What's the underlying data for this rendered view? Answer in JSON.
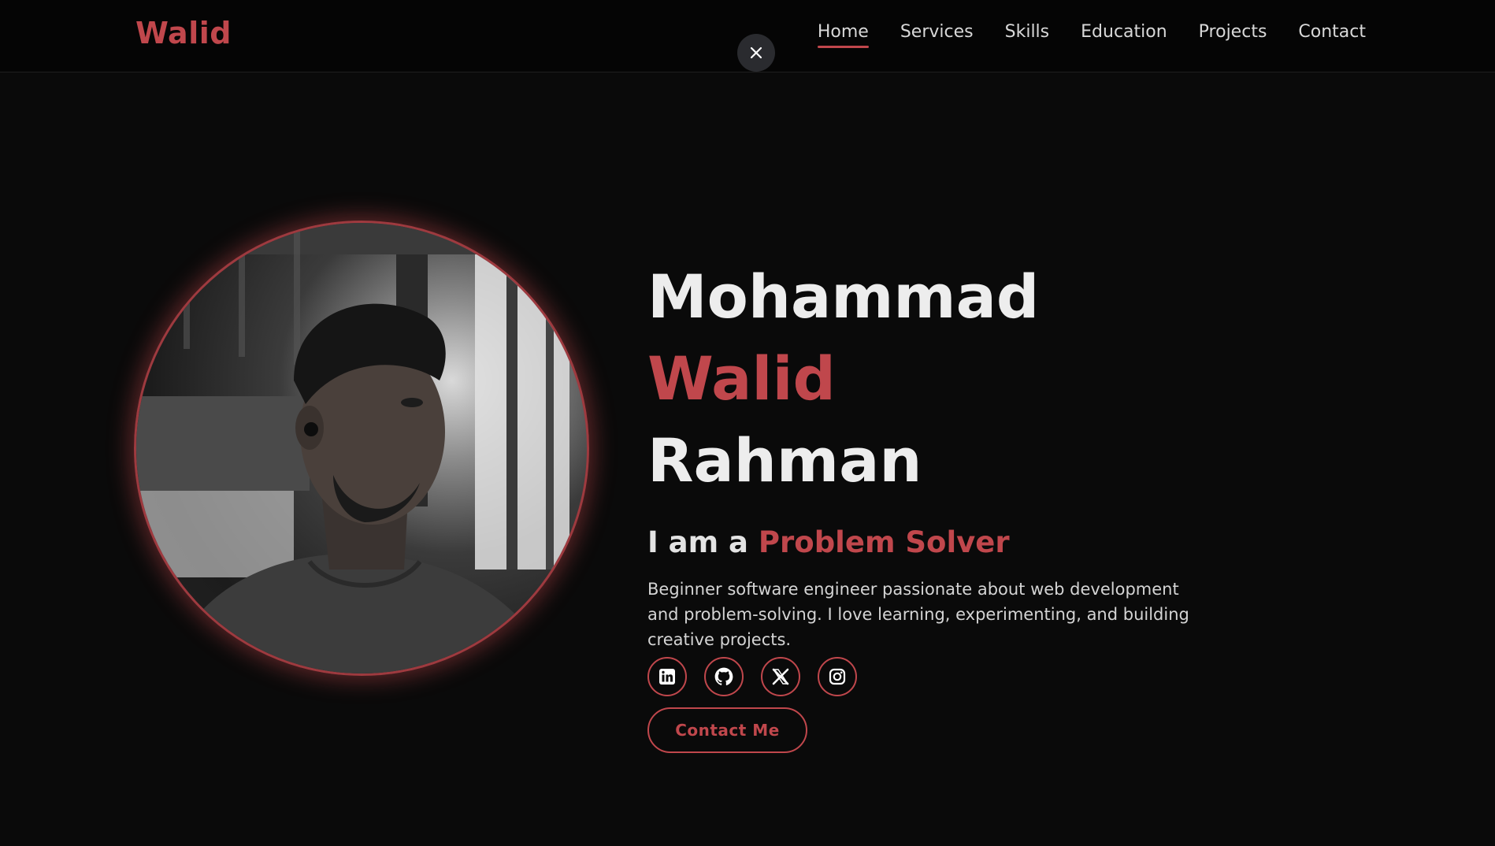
{
  "header": {
    "logo": "Walid",
    "close_icon": "close-icon",
    "nav": [
      {
        "label": "Home",
        "active": true
      },
      {
        "label": "Services",
        "active": false
      },
      {
        "label": "Skills",
        "active": false
      },
      {
        "label": "Education",
        "active": false
      },
      {
        "label": "Projects",
        "active": false
      },
      {
        "label": "Contact",
        "active": false
      }
    ]
  },
  "hero": {
    "name_first": "Mohammad ",
    "name_accent": "Walid",
    "name_last": "Rahman",
    "role_prefix": "I am a ",
    "role_accent": "Problem Solver",
    "description": "Beginner software engineer passionate about web development and problem-solving. I love learning, experimenting, and building creative projects.",
    "socials": [
      {
        "icon": "linkedin-icon"
      },
      {
        "icon": "github-icon"
      },
      {
        "icon": "x-icon"
      },
      {
        "icon": "instagram-icon"
      }
    ],
    "cta_label": "Contact Me",
    "photo_icon": "profile-photo"
  },
  "colors": {
    "accent": "#c0474c",
    "background": "#0a0a0a",
    "navbar": "#050505",
    "text": "#e6e6e6"
  }
}
